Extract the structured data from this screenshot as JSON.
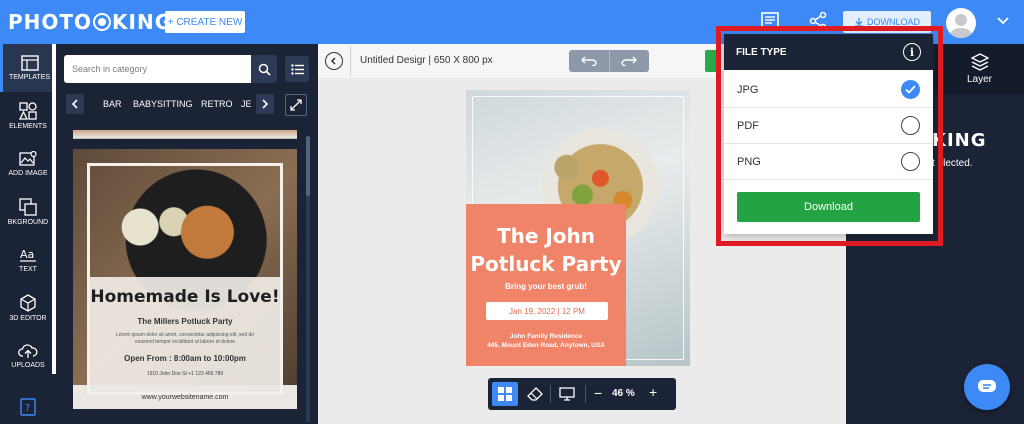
{
  "header": {
    "logo": {
      "left": "PHOTO",
      "right": "KING"
    },
    "create_new": "+ CREATE NEW",
    "download": "DOWNLOAD"
  },
  "left_nav": {
    "items": [
      {
        "label": "TEMPLATES",
        "icon": "templates-icon"
      },
      {
        "label": "ELEMENTS",
        "icon": "elements-icon"
      },
      {
        "label": "ADD IMAGE",
        "icon": "add-image-icon"
      },
      {
        "label": "BKGROUND",
        "icon": "background-icon"
      },
      {
        "label": "TEXT",
        "icon": "text-icon"
      },
      {
        "label": "3D EDITOR",
        "icon": "3d-editor-icon"
      },
      {
        "label": "UPLOADS",
        "icon": "uploads-icon"
      }
    ]
  },
  "template_panel": {
    "search_placeholder": "Search in category",
    "categories": [
      "BAR",
      "BABYSITTING",
      "RETRO",
      "JE"
    ],
    "thumbnail": {
      "title": "Homemade Is Love!",
      "subtitle": "The Millers Potluck Party",
      "body": "Lorem ipsum dolor sit amet, consectetur adipiscing elit, sed do eiusmod tempor incididunt ut labore et dolore",
      "hours": "Open From : 8:00am to 10:00pm",
      "address": "1910 John Doe St +1 123 456 789",
      "website": "www.yourwebsitename.com"
    }
  },
  "canvas": {
    "doc_title": "Untitled Desigr",
    "doc_size": "650 X 800 px",
    "design": {
      "title_line1": "The John",
      "title_line2": "Potluck Party",
      "subtitle": "Bring your best grub!",
      "date": "Jan 19, 2022 | 12 PM",
      "venue_line1": "John Family Residence",
      "venue_line2": "445, Mount Eden Road, Anytown, USA"
    },
    "zoom": "46 %"
  },
  "right_panel": {
    "layer_tab": "Layer",
    "logo_text": "KING",
    "hint_text": "t elected."
  },
  "file_type": {
    "title": "FILE TYPE",
    "options": [
      {
        "label": "JPG",
        "checked": true
      },
      {
        "label": "PDF",
        "checked": false
      },
      {
        "label": "PNG",
        "checked": false
      }
    ],
    "download_label": "Download"
  },
  "colors": {
    "brand_blue": "#3d8af7",
    "dark_navy": "#1b2336",
    "download_green": "#23a343",
    "highlight_red": "#e21b23",
    "poster_orange": "#f08468"
  }
}
